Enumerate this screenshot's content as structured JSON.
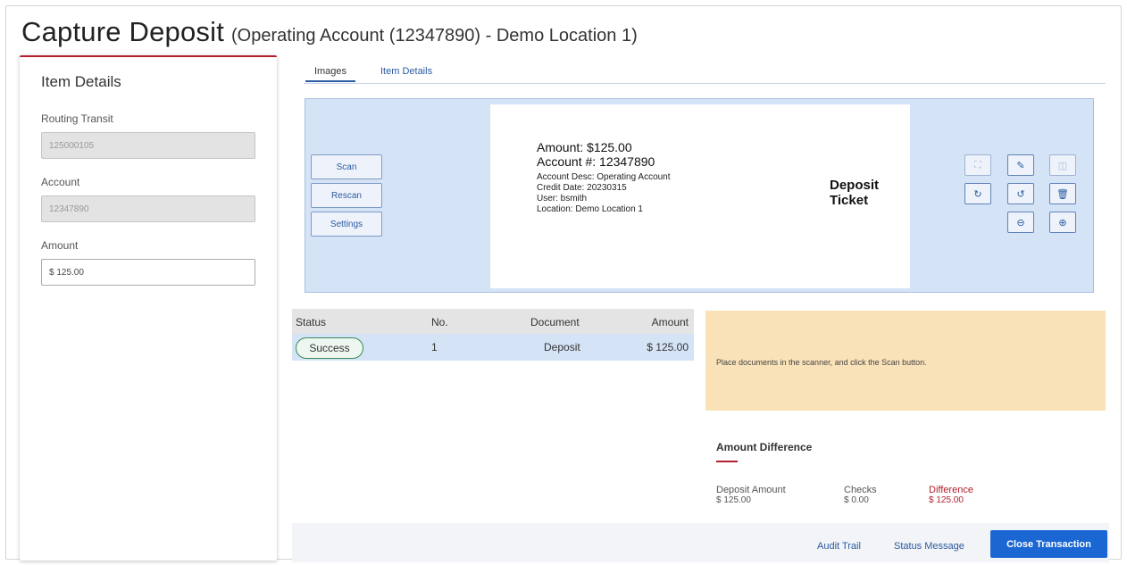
{
  "header": {
    "title": "Capture Deposit",
    "subtitle": "(Operating Account (12347890) - Demo Location 1)"
  },
  "item_details": {
    "heading": "Item Details",
    "routing_label": "Routing Transit",
    "routing_value": "125000105",
    "account_label": "Account",
    "account_value": "12347890",
    "amount_label": "Amount",
    "amount_value": "$ 125.00"
  },
  "tabs": [
    {
      "label": "Images",
      "active": true
    },
    {
      "label": "Item Details",
      "active": false
    }
  ],
  "scanner": {
    "scan_label": "Scan",
    "rescan_label": "Rescan",
    "settings_label": "Settings"
  },
  "ticket": {
    "amount": "Amount: $125.00",
    "account": "Account #:  12347890",
    "desc": "Account Desc: Operating Account",
    "credit_date": "Credit Date:  20230315",
    "user": "User:  bsmith",
    "location": "Location:  Demo Location 1",
    "title_line1": "Deposit",
    "title_line2": "Ticket"
  },
  "tools": [
    {
      "icon": "fit-screen-icon",
      "glyph": "⛶",
      "enabled": false
    },
    {
      "icon": "edit-icon",
      "glyph": "✎",
      "enabled": true
    },
    {
      "icon": "split-icon",
      "glyph": "◫",
      "enabled": false
    },
    {
      "icon": "rotate-clockwise-icon",
      "glyph": "↻",
      "enabled": true
    },
    {
      "icon": "rotate-counterclockwise-icon",
      "glyph": "↺",
      "enabled": true
    },
    {
      "icon": "delete-icon",
      "glyph": "🗑",
      "enabled": true
    },
    {
      "icon": "zoom-out-icon",
      "glyph": "⊖",
      "enabled": true
    },
    {
      "icon": "zoom-in-icon",
      "glyph": "⊕",
      "enabled": true
    }
  ],
  "table": {
    "headers": [
      "Status",
      "No.",
      "Document",
      "Amount"
    ],
    "rows": [
      {
        "status": "Success",
        "no": "1",
        "document": "Deposit",
        "amount": "$ 125.00"
      }
    ]
  },
  "message": "Place documents in the scanner, and click the Scan button.",
  "amount_difference": {
    "heading": "Amount Difference",
    "deposit_label": "Deposit Amount",
    "deposit_value": "$ 125.00",
    "checks_label": "Checks",
    "checks_value": "$ 0.00",
    "difference_label": "Difference",
    "difference_value": "$ 125.00"
  },
  "footer": {
    "audit_trail": "Audit Trail",
    "status_message": "Status Message",
    "close_transaction": "Close Transaction"
  },
  "colors": {
    "accent": "#b3202e",
    "primary": "#1a66d2",
    "scan_bg": "#d5e3f6",
    "message_bg": "#fae2b8",
    "success": "#3c8a5a"
  }
}
